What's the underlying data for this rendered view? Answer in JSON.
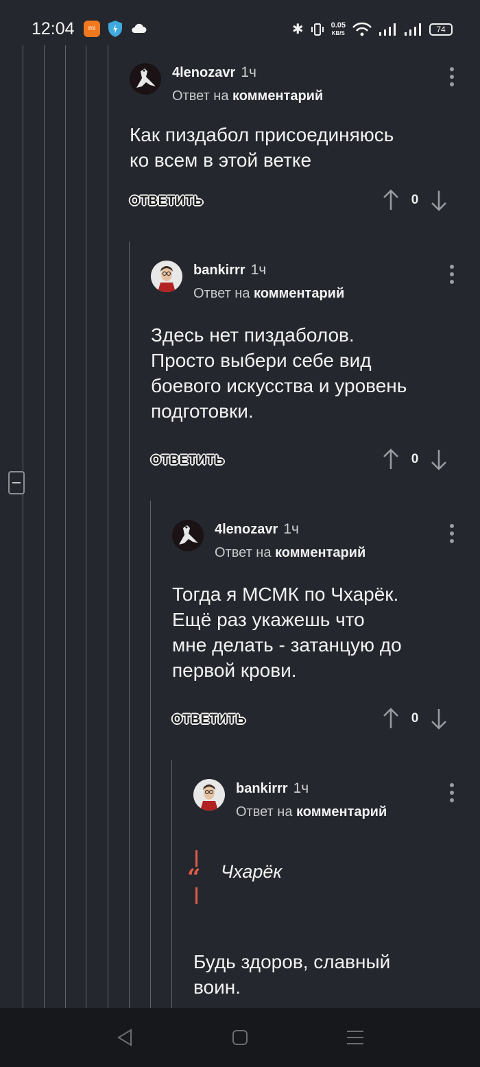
{
  "status_bar": {
    "time": "12:04",
    "net_speed_value": "0.05",
    "net_speed_unit": "KB/S",
    "battery": "74"
  },
  "comments": [
    {
      "author": "4lenozavr",
      "time": "1ч",
      "reply_prefix": "Ответ на",
      "reply_target": "комментарий",
      "text_lines": [
        "Как пиздабол присоединяюсь",
        "ко всем в этой ветке"
      ],
      "answer_label": "ОТВЕТИТЬ",
      "score": "0"
    },
    {
      "author": "bankirrr",
      "time": "1ч",
      "reply_prefix": "Ответ на",
      "reply_target": "комментарий",
      "text_lines": [
        "Здесь нет пиздаболов.",
        "Просто выбери себе вид",
        "боевого искусства и уровень",
        "подготовки."
      ],
      "answer_label": "ОТВЕТИТЬ",
      "score": "0"
    },
    {
      "author": "4lenozavr",
      "time": "1ч",
      "reply_prefix": "Ответ на",
      "reply_target": "комментарий",
      "text_lines": [
        "Тогда я МСМК по Чхарёк.",
        "Ещё раз укажешь что",
        "мне делать - затанцую до",
        "первой крови."
      ],
      "answer_label": "ОТВЕТИТЬ",
      "score": "0"
    },
    {
      "author": "bankirrr",
      "time": "1ч",
      "reply_prefix": "Ответ на",
      "reply_target": "комментарий",
      "quote": "Чхарёк",
      "text_lines": [
        "Будь здоров, славный",
        "воин."
      ]
    }
  ]
}
